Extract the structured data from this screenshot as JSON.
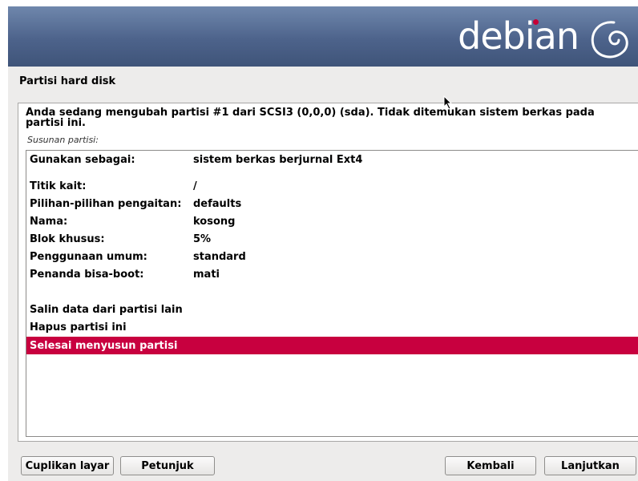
{
  "banner": {
    "logo_text": "debian",
    "logo_dot_color": "#c70036"
  },
  "step_title": "Partisi hard disk",
  "description": "Anda sedang mengubah partisi #1 dari SCSI3 (0,0,0) (sda). Tidak ditemukan sistem berkas pada partisi ini.",
  "subtitle": "Susunan partisi:",
  "settings": [
    {
      "label": "Gunakan sebagai:",
      "value": "sistem berkas berjurnal Ext4"
    },
    {
      "label": "Titik kait:",
      "value": "/"
    },
    {
      "label": "Pilihan-pilihan pengaitan:",
      "value": "defaults"
    },
    {
      "label": "Nama:",
      "value": "kosong"
    },
    {
      "label": "Blok khusus:",
      "value": "5%"
    },
    {
      "label": "Penggunaan umum:",
      "value": "standard"
    },
    {
      "label": "Penanda bisa-boot:",
      "value": "mati"
    }
  ],
  "actions": [
    {
      "label": "Salin data dari partisi lain"
    },
    {
      "label": "Hapus partisi ini"
    },
    {
      "label": "Selesai menyusun partisi"
    }
  ],
  "selected_color": "#c8003f",
  "buttons": {
    "screenshot": "Cuplikan layar",
    "help": "Petunjuk",
    "back": "Kembali",
    "continue": "Lanjutkan"
  }
}
